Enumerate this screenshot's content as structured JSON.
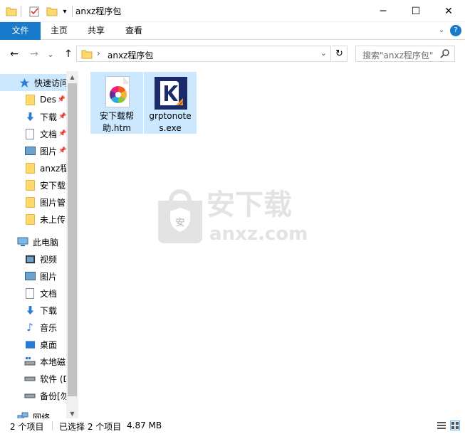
{
  "window": {
    "title": "anxz程序包",
    "controls": {
      "minimize": "─",
      "maximize": "☐",
      "close": "✕"
    }
  },
  "ribbon": {
    "tabs": [
      {
        "label": "文件"
      },
      {
        "label": "主页"
      },
      {
        "label": "共享"
      },
      {
        "label": "查看"
      }
    ],
    "help": "?"
  },
  "address": {
    "back": "←",
    "forward": "→",
    "recent": "⌄",
    "up": "↑",
    "path_sep": "›",
    "path": "anxz程序包",
    "dropdown": "⌄",
    "refresh": "↻"
  },
  "search": {
    "placeholder": "搜索\"anxz程序包\"",
    "icon": "search-icon"
  },
  "sidebar": {
    "quick_access": "快速访问",
    "quick_items": [
      {
        "label": "Des",
        "pinned": true,
        "icon": "folder-icon"
      },
      {
        "label": "下载",
        "pinned": true,
        "icon": "download-icon"
      },
      {
        "label": "文档",
        "pinned": true,
        "icon": "document-icon"
      },
      {
        "label": "图片",
        "pinned": true,
        "icon": "picture-icon"
      },
      {
        "label": "anxz程",
        "pinned": false,
        "icon": "folder-icon"
      },
      {
        "label": "安下载",
        "pinned": false,
        "icon": "folder-icon"
      },
      {
        "label": "图片管",
        "pinned": false,
        "icon": "folder-icon"
      },
      {
        "label": "未上传",
        "pinned": false,
        "icon": "folder-icon"
      }
    ],
    "this_pc": "此电脑",
    "pc_items": [
      {
        "label": "视频",
        "icon": "video-icon"
      },
      {
        "label": "图片",
        "icon": "picture-icon"
      },
      {
        "label": "文档",
        "icon": "document-icon"
      },
      {
        "label": "下载",
        "icon": "download-icon"
      },
      {
        "label": "音乐",
        "icon": "music-icon"
      },
      {
        "label": "桌面",
        "icon": "desktop-icon"
      },
      {
        "label": "本地磁",
        "icon": "local-disk-icon"
      },
      {
        "label": "软件 (D",
        "icon": "drive-icon"
      },
      {
        "label": "备份[勿",
        "icon": "drive-icon"
      }
    ],
    "network": "网络"
  },
  "files": [
    {
      "name": "安下载帮助.htm",
      "line1": "安下载帮",
      "line2": "助.htm",
      "icon": "htm-file-icon"
    },
    {
      "name": "grptonotes.exe",
      "line1": "grptonote",
      "line2": "s.exe",
      "icon": "exe-app-icon"
    }
  ],
  "watermark": {
    "cn": "安下载",
    "url": "anxz.com",
    "shield": "安"
  },
  "status": {
    "count": "2 个项目",
    "selected": "已选择 2 个项目",
    "size": "4.87 MB"
  }
}
